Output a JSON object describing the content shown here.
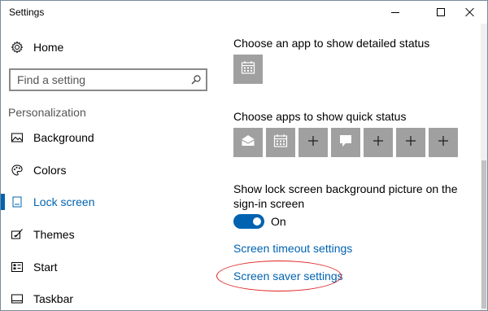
{
  "window": {
    "title": "Settings"
  },
  "sidebar": {
    "home_label": "Home",
    "search_placeholder": "Find a setting",
    "section_title": "Personalization",
    "items": [
      {
        "label": "Background",
        "icon": "picture-icon"
      },
      {
        "label": "Colors",
        "icon": "palette-icon"
      },
      {
        "label": "Lock screen",
        "icon": "lock-screen-icon",
        "active": true
      },
      {
        "label": "Themes",
        "icon": "brush-icon"
      },
      {
        "label": "Start",
        "icon": "start-grid-icon"
      },
      {
        "label": "Taskbar",
        "icon": "taskbar-icon"
      }
    ]
  },
  "main": {
    "detailed_status_title": "Choose an app to show detailed status",
    "quick_status_title": "Choose apps to show quick status",
    "signin_picture_title": "Show lock screen background picture on the sign-in screen",
    "toggle_state": "On",
    "screen_timeout_link": "Screen timeout settings",
    "screen_saver_link": "Screen saver settings"
  },
  "colors": {
    "accent": "#0063b1",
    "tile": "#a0a0a0",
    "annotation": "#e02020"
  }
}
